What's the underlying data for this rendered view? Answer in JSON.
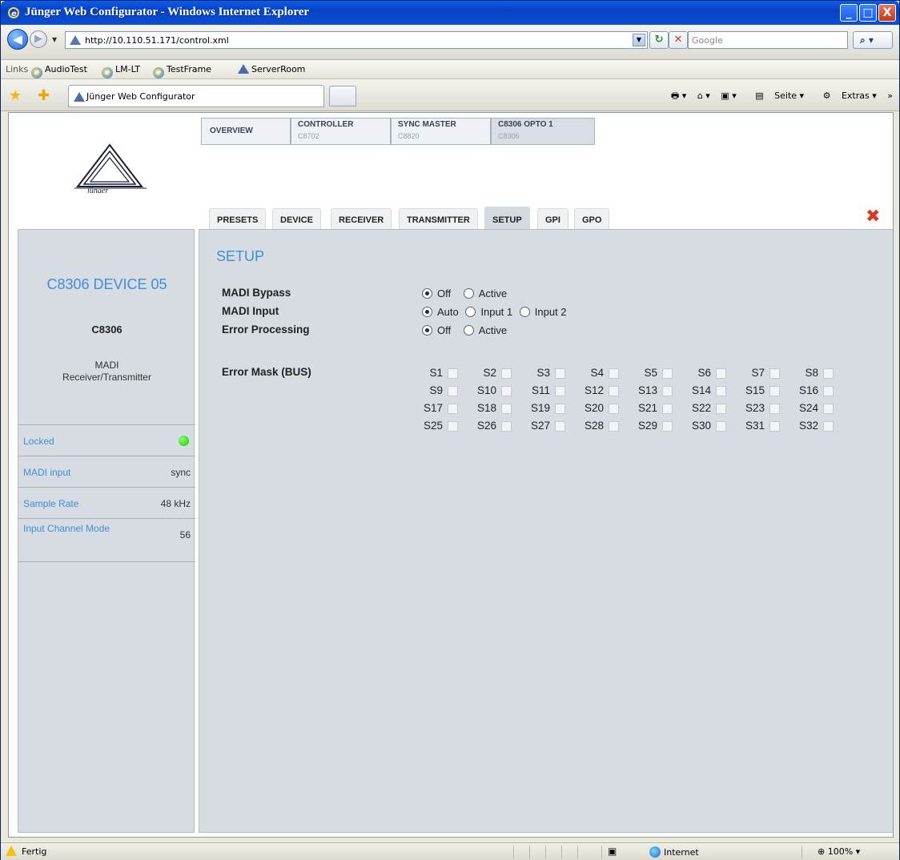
{
  "window": {
    "title": "Jünger Web Configurator - Windows Internet Explorer",
    "controls": {
      "minimize": "_",
      "maximize": "□",
      "close": "X"
    }
  },
  "addressbar": {
    "url": "http://10.110.51.171/control.xml",
    "search_placeholder": "Google"
  },
  "links": {
    "label": "Links",
    "items": [
      "AudioTest",
      "LM-LT",
      "TestFrame",
      "ServerRoom"
    ]
  },
  "browser_tab": {
    "title": "Jünger Web Configurator"
  },
  "commandbar": {
    "page": "Seite",
    "extras": "Extras"
  },
  "device_tabs": [
    {
      "title": "OVERVIEW",
      "sub": ""
    },
    {
      "title": "CONTROLLER",
      "sub": "C8702"
    },
    {
      "title": "SYNC MASTER",
      "sub": "C8820"
    },
    {
      "title": "C8306 OPTO 1",
      "sub": "C8306"
    }
  ],
  "page_tabs": [
    "PRESETS",
    "DEVICE",
    "RECEIVER",
    "TRANSMITTER",
    "SETUP",
    "GPI",
    "GPO"
  ],
  "selected_page_tab": "SETUP",
  "sidebar": {
    "device_name": "C8306 DEVICE 05",
    "model": "C8306",
    "description_line1": "MADI",
    "description_line2": "Receiver/Transmitter",
    "status": [
      {
        "key": "Locked",
        "value": "",
        "led_color": "#12c800"
      },
      {
        "key": "MADI input",
        "value": "sync"
      },
      {
        "key": "Sample Rate",
        "value": "48 kHz"
      },
      {
        "key": "Input Channel Mode",
        "value": "56"
      }
    ]
  },
  "setup": {
    "heading": "SETUP",
    "madi_bypass": {
      "label": "MADI Bypass",
      "options": [
        "Off",
        "Active"
      ],
      "selected": "Off"
    },
    "madi_input": {
      "label": "MADI Input",
      "options": [
        "Auto",
        "Input 1",
        "Input 2"
      ],
      "selected": "Auto"
    },
    "error_processing": {
      "label": "Error Processing",
      "options": [
        "Off",
        "Active"
      ],
      "selected": "Off"
    },
    "error_mask": {
      "label": "Error Mask (BUS)",
      "channels": [
        "S1",
        "S2",
        "S3",
        "S4",
        "S5",
        "S6",
        "S7",
        "S8",
        "S9",
        "S10",
        "S11",
        "S12",
        "S13",
        "S14",
        "S15",
        "S16",
        "S17",
        "S18",
        "S19",
        "S20",
        "S21",
        "S22",
        "S23",
        "S24",
        "S25",
        "S26",
        "S27",
        "S28",
        "S29",
        "S30",
        "S31",
        "S32"
      ]
    }
  },
  "statusbar": {
    "text": "Fertig",
    "zone": "Internet",
    "zoom": "100%"
  },
  "colors": {
    "accent_blue": "#3f8fd8",
    "panel_bg": "#d7dbe2",
    "close_red": "#d93a1e"
  }
}
